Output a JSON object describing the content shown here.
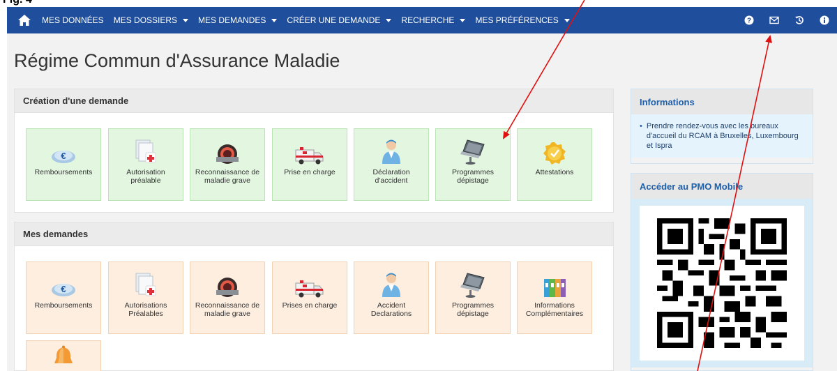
{
  "fig_label": "Fig. 4",
  "nav": {
    "home_icon": "home-icon",
    "items": [
      {
        "label": "MES DONNÉES",
        "dropdown": false
      },
      {
        "label": "MES DOSSIERS",
        "dropdown": true
      },
      {
        "label": "MES DEMANDES",
        "dropdown": true
      },
      {
        "label": "CRÉER UNE DEMANDE",
        "dropdown": true
      },
      {
        "label": "RECHERCHE",
        "dropdown": true
      },
      {
        "label": "MES PRÉFÉRENCES",
        "dropdown": true
      }
    ],
    "right_icons": [
      "help-icon",
      "mail-icon",
      "history-icon",
      "info-icon"
    ]
  },
  "page_title": "Régime Commun d'Assurance Maladie",
  "creation": {
    "title": "Création d'une demande",
    "tiles": [
      {
        "label": "Remboursements",
        "icon": "euro-icon"
      },
      {
        "label": "Autorisation préalable",
        "icon": "medical-form-icon"
      },
      {
        "label": "Reconnaissance de maladie grave",
        "icon": "scanner-icon"
      },
      {
        "label": "Prise en charge",
        "icon": "ambulance-icon"
      },
      {
        "label": "Déclaration d'accident",
        "icon": "doctor-icon"
      },
      {
        "label": "Programmes dépistage",
        "icon": "laptop-icon"
      },
      {
        "label": "Attestations",
        "icon": "badge-icon"
      }
    ]
  },
  "requests": {
    "title": "Mes demandes",
    "tiles": [
      {
        "label": "Remboursements",
        "icon": "euro-icon"
      },
      {
        "label": "Autorisations Préalables",
        "icon": "medical-form-icon"
      },
      {
        "label": "Reconnaissance de maladie grave",
        "icon": "scanner-icon"
      },
      {
        "label": "Prises en charge",
        "icon": "ambulance-icon"
      },
      {
        "label": "Accident Declarations",
        "icon": "doctor-icon"
      },
      {
        "label": "Programmes dépistage",
        "icon": "laptop-icon"
      },
      {
        "label": "Informations Complémentaires",
        "icon": "binders-icon"
      },
      {
        "label": "",
        "icon": "bell-icon"
      }
    ]
  },
  "info": {
    "title": "Informations",
    "text": "Prendre rendez-vous avec les bureaux d'accueil du RCAM à Bruxelles, Luxembourg et Ispra"
  },
  "mobile": {
    "title": "Accéder au PMO Mobile",
    "qr_icon": "qr-code-icon"
  },
  "colors": {
    "navbar": "#1f4e9c",
    "green_tile": "#e2f6e0",
    "peach_tile": "#fdeee0",
    "annotation_arrow": "#e01010"
  }
}
